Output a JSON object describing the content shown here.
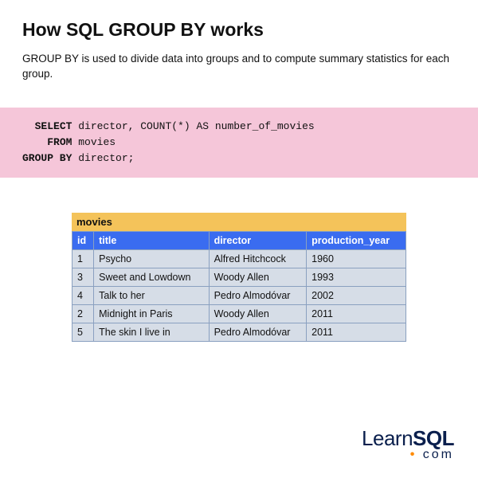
{
  "title": "How SQL GROUP BY works",
  "description": "GROUP BY is used to divide data into groups and to compute summary statistics for each group.",
  "code": {
    "kw_select": "SELECT",
    "select_rest": " director, COUNT(*) AS number_of_movies",
    "kw_from": "FROM",
    "from_rest": " movies",
    "kw_groupby": "GROUP BY",
    "groupby_rest": " director;"
  },
  "table": {
    "name": "movies",
    "headers": [
      "id",
      "title",
      "director",
      "production_year"
    ],
    "rows": [
      [
        "1",
        "Psycho",
        "Alfred Hitchcock",
        "1960"
      ],
      [
        "3",
        "Sweet and Lowdown",
        "Woody Allen",
        "1993"
      ],
      [
        "4",
        "Talk to her",
        "Pedro Almodóvar",
        "2002"
      ],
      [
        "2",
        "Midnight in Paris",
        "Woody Allen",
        "2011"
      ],
      [
        "5",
        "The skin I live in",
        "Pedro Almodóvar",
        "2011"
      ]
    ]
  },
  "logo": {
    "learn": "Learn",
    "sql": "SQL",
    "dot": "•",
    "com": " com"
  }
}
